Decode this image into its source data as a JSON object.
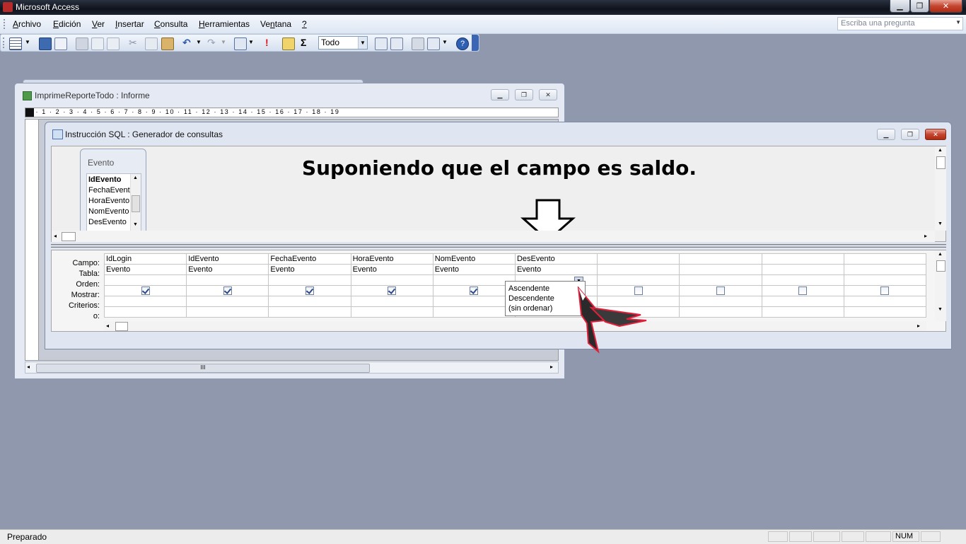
{
  "app": {
    "title": "Microsoft Access"
  },
  "menu": {
    "items": [
      {
        "label": "Archivo",
        "u": "A",
        "rest": "rchivo"
      },
      {
        "label": "Edición",
        "u": "E",
        "rest": "dición"
      },
      {
        "label": "Ver",
        "u": "V",
        "rest": "er"
      },
      {
        "label": "Insertar",
        "u": "I",
        "rest": "nsertar"
      },
      {
        "label": "Consulta",
        "u": "C",
        "rest": "onsulta"
      },
      {
        "label": "Herramientas",
        "u": "H",
        "rest": "erramientas"
      },
      {
        "label": "Ventana",
        "u": "n",
        "pre": "Ve",
        "rest": "tana"
      },
      {
        "label": "?",
        "u": "?",
        "rest": ""
      }
    ],
    "help_placeholder": "Escriba una pregunta"
  },
  "toolbar": {
    "top_values": "Todo",
    "sigma_glyph": "Σ",
    "run_glyph": "!"
  },
  "report_window": {
    "title": "ImprimeReporteTodo : Informe",
    "ruler_text": "· 1 · 2 · 3 · 4 · 5 · 6 · 7 · 8 · 9 · 10 · 11 · 12 · 13 · 14 · 15 · 16 · 17 · 18 · 19",
    "hscroll_thumb": "III"
  },
  "query_window": {
    "title": "Instrucción SQL : Generador de consultas",
    "table": {
      "name": "Evento",
      "fields": [
        "IdEvento",
        "FechaEvent",
        "HoraEvento",
        "NomEvento",
        "DesEvento"
      ]
    },
    "annotation": "Suponiendo que el campo es saldo.",
    "row_labels": [
      "Campo:",
      "Tabla:",
      "Orden:",
      "Mostrar:",
      "Criterios:",
      "o:"
    ],
    "columns": [
      {
        "campo": "IdLogin",
        "tabla": "Evento",
        "mostrar": true
      },
      {
        "campo": "IdEvento",
        "tabla": "Evento",
        "mostrar": true
      },
      {
        "campo": "FechaEvento",
        "tabla": "Evento",
        "mostrar": true
      },
      {
        "campo": "HoraEvento",
        "tabla": "Evento",
        "mostrar": true
      },
      {
        "campo": "NomEvento",
        "tabla": "Evento",
        "mostrar": true
      },
      {
        "campo": "DesEvento",
        "tabla": "Evento",
        "mostrar": false
      },
      {
        "campo": "",
        "tabla": "",
        "mostrar": false
      },
      {
        "campo": "",
        "tabla": "",
        "mostrar": false
      },
      {
        "campo": "",
        "tabla": "",
        "mostrar": false
      },
      {
        "campo": "",
        "tabla": "",
        "mostrar": false
      }
    ],
    "sort_options": [
      "Ascendente",
      "Descendente",
      "(sin ordenar)"
    ]
  },
  "status": {
    "text": "Preparado",
    "num_indicator": "NUM"
  },
  "colors": {
    "workspace": "#8f98ad",
    "close_button": "#c44631",
    "cursor_accent": "#e0203a"
  }
}
